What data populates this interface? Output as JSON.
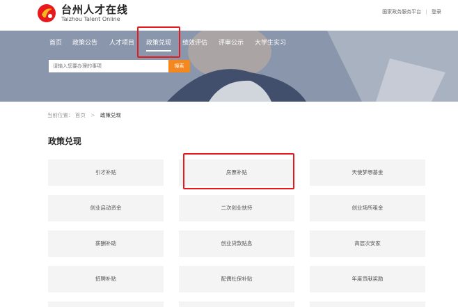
{
  "brand": {
    "name_cn": "台州人才在线",
    "name_en": "Taizhou Talent Online"
  },
  "top_links": {
    "platform": "国家政务服务平台",
    "login": "登录"
  },
  "nav": {
    "items": [
      {
        "label": "首页"
      },
      {
        "label": "政策公告"
      },
      {
        "label": "人才项目"
      },
      {
        "label": "政策兑现"
      },
      {
        "label": "绩效评估"
      },
      {
        "label": "评审公示"
      },
      {
        "label": "大学生实习"
      }
    ],
    "active": "政策兑现"
  },
  "search": {
    "placeholder": "请输入您要办理的事项",
    "button": "搜索"
  },
  "breadcrumb": {
    "prefix": "当前位置：",
    "home": "首页",
    "separator": ">",
    "current": "政策兑现"
  },
  "section": {
    "title": "政策兑现"
  },
  "policies": [
    {
      "label": "引才补贴"
    },
    {
      "label": "房票补贴"
    },
    {
      "label": "天使梦想基金"
    },
    {
      "label": "创业启动资金"
    },
    {
      "label": "二次创业扶持"
    },
    {
      "label": "创业场所租金"
    },
    {
      "label": "薪酬补助"
    },
    {
      "label": "创业贷款贴息"
    },
    {
      "label": "高层次安家"
    },
    {
      "label": "招聘补贴"
    },
    {
      "label": "配偶社保补贴"
    },
    {
      "label": "年度贡献奖励"
    }
  ],
  "colors": {
    "accent_orange": "#f5871f",
    "highlight_red": "#e8191d",
    "tile_bg": "#f4f4f4"
  }
}
